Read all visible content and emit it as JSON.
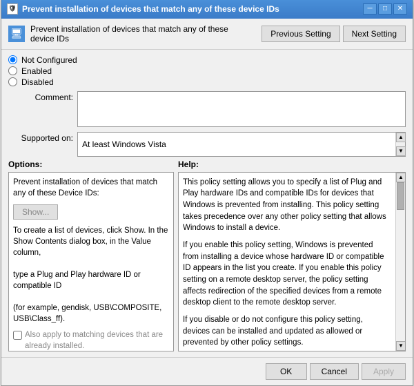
{
  "window": {
    "title": "Prevent installation of devices that match any of these device IDs",
    "icon": "🛡"
  },
  "header": {
    "title": "Prevent installation of devices that match any of these device IDs",
    "prev_button": "Previous Setting",
    "next_button": "Next Setting"
  },
  "radio": {
    "options": [
      {
        "label": "Not Configured",
        "value": "not-configured",
        "checked": true
      },
      {
        "label": "Enabled",
        "value": "enabled",
        "checked": false
      },
      {
        "label": "Disabled",
        "value": "disabled",
        "checked": false
      }
    ]
  },
  "comment": {
    "label": "Comment:",
    "placeholder": ""
  },
  "supported": {
    "label": "Supported on:",
    "value": "At least Windows Vista"
  },
  "options": {
    "label": "Options:",
    "description": "Prevent installation of devices that match any of these Device IDs:",
    "show_button": "Show...",
    "instructions": "To create a list of devices, click Show. In the Show Contents dialog box, in the Value column,\n\ntype a Plug and Play hardware ID or compatible ID\n\n(for example, gendisk, USB\\COMPOSITE, USB\\Class_ff).",
    "checkbox_label": "Also apply to matching devices that are already installed."
  },
  "help": {
    "label": "Help:",
    "paragraphs": [
      "This policy setting allows you to specify a list of Plug and Play hardware IDs and compatible IDs for devices that Windows is prevented from installing. This policy setting takes precedence over any other policy setting that allows Windows to install a device.",
      "If you enable this policy setting, Windows is prevented from installing a device whose hardware ID or compatible ID appears in the list you create. If you enable this policy setting on a remote desktop server, the policy setting affects redirection of the specified devices from a remote desktop client to the remote desktop server.",
      "If you disable or do not configure this policy setting, devices can be installed and updated as allowed or prevented by other policy settings."
    ]
  },
  "footer": {
    "ok": "OK",
    "cancel": "Cancel",
    "apply": "Apply"
  },
  "title_buttons": {
    "minimize": "─",
    "maximize": "□",
    "close": "✕"
  }
}
